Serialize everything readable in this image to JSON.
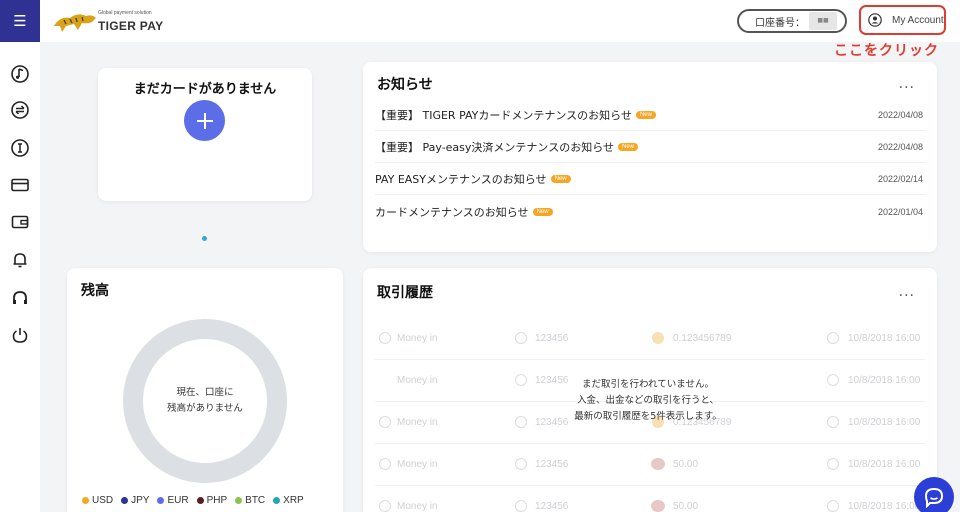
{
  "header": {
    "menu_icon": "hamburger-icon",
    "logo_tagline": "Global payment solution",
    "logo_name": "TIGER PAY",
    "account_number_label": "口座番号：",
    "account_number_mask": "■■",
    "my_account_label": "My Account",
    "callout_text": "ここをクリック",
    "callout_color": "#e03b2f"
  },
  "sidebar": {
    "items": [
      {
        "icon": "music-note-circle-icon"
      },
      {
        "icon": "exchange-circle-icon"
      },
      {
        "icon": "info-circle-icon"
      },
      {
        "icon": "credit-card-icon"
      },
      {
        "icon": "wallet-icon"
      },
      {
        "icon": "bell-icon"
      },
      {
        "icon": "headset-icon"
      },
      {
        "icon": "power-icon"
      }
    ]
  },
  "cards": {
    "empty_title": "まだカードがありません",
    "add_icon": "plus-icon"
  },
  "news": {
    "title": "お知らせ",
    "more": "...",
    "items": [
      {
        "text": "【重要】 TIGER PAYカードメンテナンスのお知らせ",
        "badge": "New",
        "date": "2022/04/08"
      },
      {
        "text": "【重要】 Pay-easy決済メンテナンスのお知らせ",
        "badge": "New",
        "date": "2022/04/08"
      },
      {
        "text": "PAY EASYメンテナンスのお知らせ",
        "badge": "New",
        "date": "2022/02/14"
      },
      {
        "text": "カードメンテナンスのお知らせ",
        "badge": "New",
        "date": "2022/01/04"
      }
    ]
  },
  "balance": {
    "title": "残高",
    "empty_line1": "現在、口座に",
    "empty_line2": "残高がありません",
    "legend": [
      {
        "label": "USD",
        "color": "#f6a623"
      },
      {
        "label": "JPY",
        "color": "#2f3292"
      },
      {
        "label": "EUR",
        "color": "#5b6ee8"
      },
      {
        "label": "PHP",
        "color": "#5a1e1e"
      },
      {
        "label": "BTC",
        "color": "#8bc34a"
      },
      {
        "label": "XRP",
        "color": "#26a6b5"
      }
    ]
  },
  "history": {
    "title": "取引履歴",
    "more": "...",
    "empty_line1": "まだ取引を行われていません。",
    "empty_line2": "入金、出金などの取引を行うと、",
    "empty_line3": "最新の取引履歴を5件表示します。",
    "placeholder_rows": [
      {
        "type": "Money in",
        "id": "123456",
        "amount": "0.123456789",
        "date": "10/8/2018 16:00"
      },
      {
        "type": "Money in",
        "id": "123456",
        "amount": "",
        "date": "10/8/2018 16:00"
      },
      {
        "type": "Money in",
        "id": "123456",
        "amount": "0.123456789",
        "date": "10/8/2018 16:00"
      },
      {
        "type": "Money in",
        "id": "123456",
        "amount": "50.00",
        "date": "10/8/2018 16:00"
      },
      {
        "type": "Money in",
        "id": "123456",
        "amount": "50.00",
        "date": "10/8/2018 16:00"
      }
    ]
  },
  "chat": {
    "icon": "chat-bubble-icon"
  }
}
